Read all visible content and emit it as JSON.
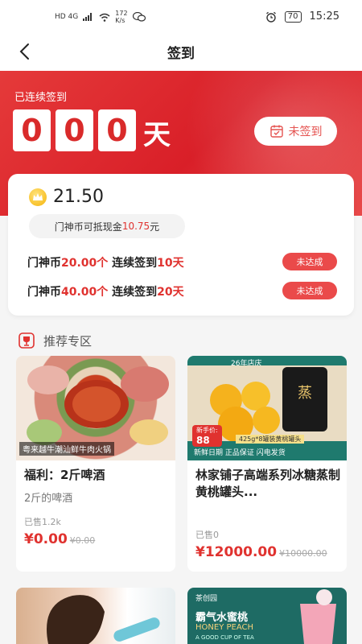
{
  "status_bar": {
    "network": "HD 4G",
    "speed_value": "172",
    "speed_unit": "K/s",
    "battery": "70",
    "time": "15:25"
  },
  "nav": {
    "title": "签到",
    "back_icon": "chevron-left-icon"
  },
  "hero": {
    "streak_label": "已连续签到",
    "digits": [
      "0",
      "0",
      "0"
    ],
    "unit": "天",
    "signin_button": "未签到",
    "colors": {
      "hero_red": "#e02b2b",
      "accent_red": "#e0322f"
    }
  },
  "coins": {
    "balance": "21.50",
    "cash_prefix": "门神币可抵现金",
    "cash_value": "10.75",
    "cash_suffix": "元"
  },
  "tasks": [
    {
      "prefix": "门神币",
      "coin_amount": "20.00个",
      "middle": " 连续签到",
      "days": "10天",
      "status": "未达成"
    },
    {
      "prefix": "门神币",
      "coin_amount": "40.00个",
      "middle": " 连续签到",
      "days": "20天",
      "status": "未达成"
    }
  ],
  "section": {
    "title": "推荐专区",
    "icon": "trophy-icon"
  },
  "products": [
    {
      "image_caption": "粤来越牛潮汕鲜牛肉火锅",
      "name": "福利：2斤啤酒",
      "subtitle": "2斤的啤酒",
      "sold": "已售1.2k",
      "price": "¥0.00",
      "original_price": "¥0.00"
    },
    {
      "image_banner": "26年店庆",
      "image_badge_label": "新手价:",
      "image_badge_value": "88",
      "image_strip": "425g*8罐装黄桃罐头",
      "image_strip2": "新鲜日期 正品保证 闪电发货",
      "name": "林家铺子高端系列冰糖蒸制黄桃罐头...",
      "subtitle": "",
      "sold": "已售0",
      "price": "¥12000.00",
      "original_price": "¥10000.00"
    },
    {
      "image_caption": ""
    },
    {
      "image_brand": "茶创园",
      "image_title": "霸气水蜜桃",
      "image_title_en": "HONEY PEACH",
      "image_sub_en": "A GOOD CUP OF TEA"
    }
  ]
}
